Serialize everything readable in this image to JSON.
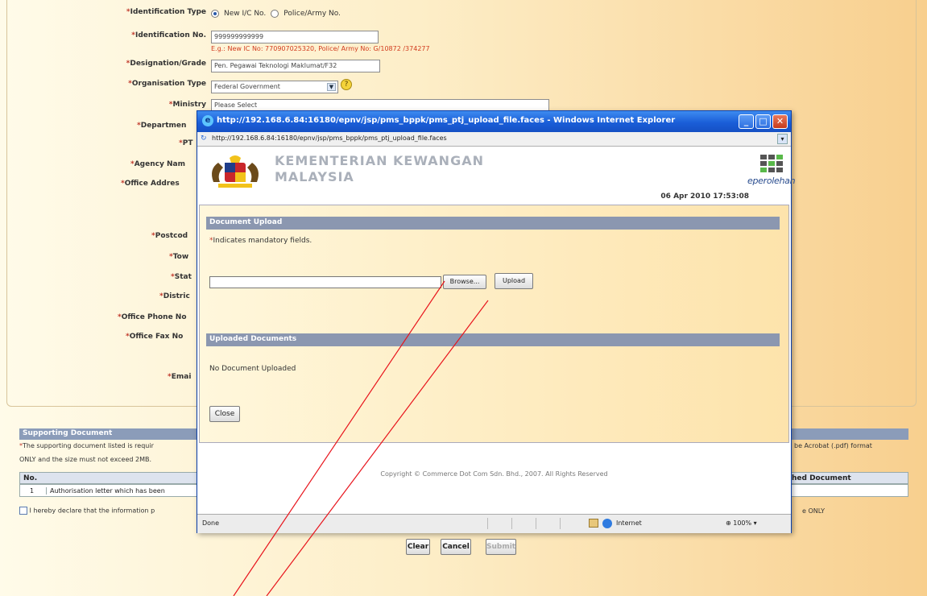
{
  "background_form": {
    "labels": {
      "identification_type": "Identification Type",
      "identification_no": "Identification No.",
      "designation": "Designation/Grade",
      "organisation_type": "Organisation Type",
      "ministry": "Ministry",
      "department": "Departmen",
      "ptj": "PT",
      "agency_name": "Agency Nam",
      "office_address": "Office Addres",
      "postcode": "Postcod",
      "town": "Tow",
      "state": "Stat",
      "district": "Distric",
      "office_phone": "Office Phone No",
      "office_fax": "Office Fax No",
      "email": "Emai"
    },
    "radio_new_ic": "New I/C No.",
    "radio_police": "Police/Army No.",
    "identification_no_value": "999999999999",
    "identification_hint": "E.g.: New IC No: 770907025320, Police/ Army No: G/10872 /374277",
    "designation_value": "Pen. Pegawai Teknologi Maklumat/F32",
    "organisation_type_value": "Federal Government",
    "ministry_value": "Please Select",
    "supporting_title": "Supporting Document",
    "supporting_text_1": "The supporting document listed is requir",
    "supporting_text_1_right": "be Acrobat (.pdf) format",
    "supporting_text_2": "ONLY and the size must not exceed 2MB.",
    "table_col_no": "No.",
    "table_col_attached": "hed Document",
    "table_row_no": "1",
    "table_row_text": "Authorisation letter which has been",
    "declare_text": "I hereby declare that the information p",
    "declare_text_right": "e ONLY",
    "buttons": {
      "clear": "Clear",
      "cancel": "Cancel",
      "submit": "Submit"
    }
  },
  "popup": {
    "title": "http://192.168.6.84:16180/epnv/jsp/pms_bppk/pms_ptj_upload_file.faces - Windows Internet Explorer",
    "address": "http://192.168.6.84:16180/epnv/jsp/pms_bppk/pms_ptj_upload_file.faces",
    "brand_line1": "KEMENTERIAN KEWANGAN",
    "brand_line2": "MALAYSIA",
    "datetime": "06 Apr 2010 17:53:08",
    "ep_logo": "eperolehan",
    "upload_section": "Document Upload",
    "mandatory_note": "Indicates mandatory fields.",
    "browse_label": "Browse...",
    "upload_label": "Upload",
    "uploaded_section": "Uploaded Documents",
    "no_docs": "No Document Uploaded",
    "close_label": "Close",
    "copyright": "Copyright © Commerce Dot Com Sdn. Bhd., 2007. All Rights Reserved",
    "status_done": "Done",
    "status_zone": "Internet",
    "status_zoom": "100%"
  },
  "annotation_color": "#e8131b"
}
